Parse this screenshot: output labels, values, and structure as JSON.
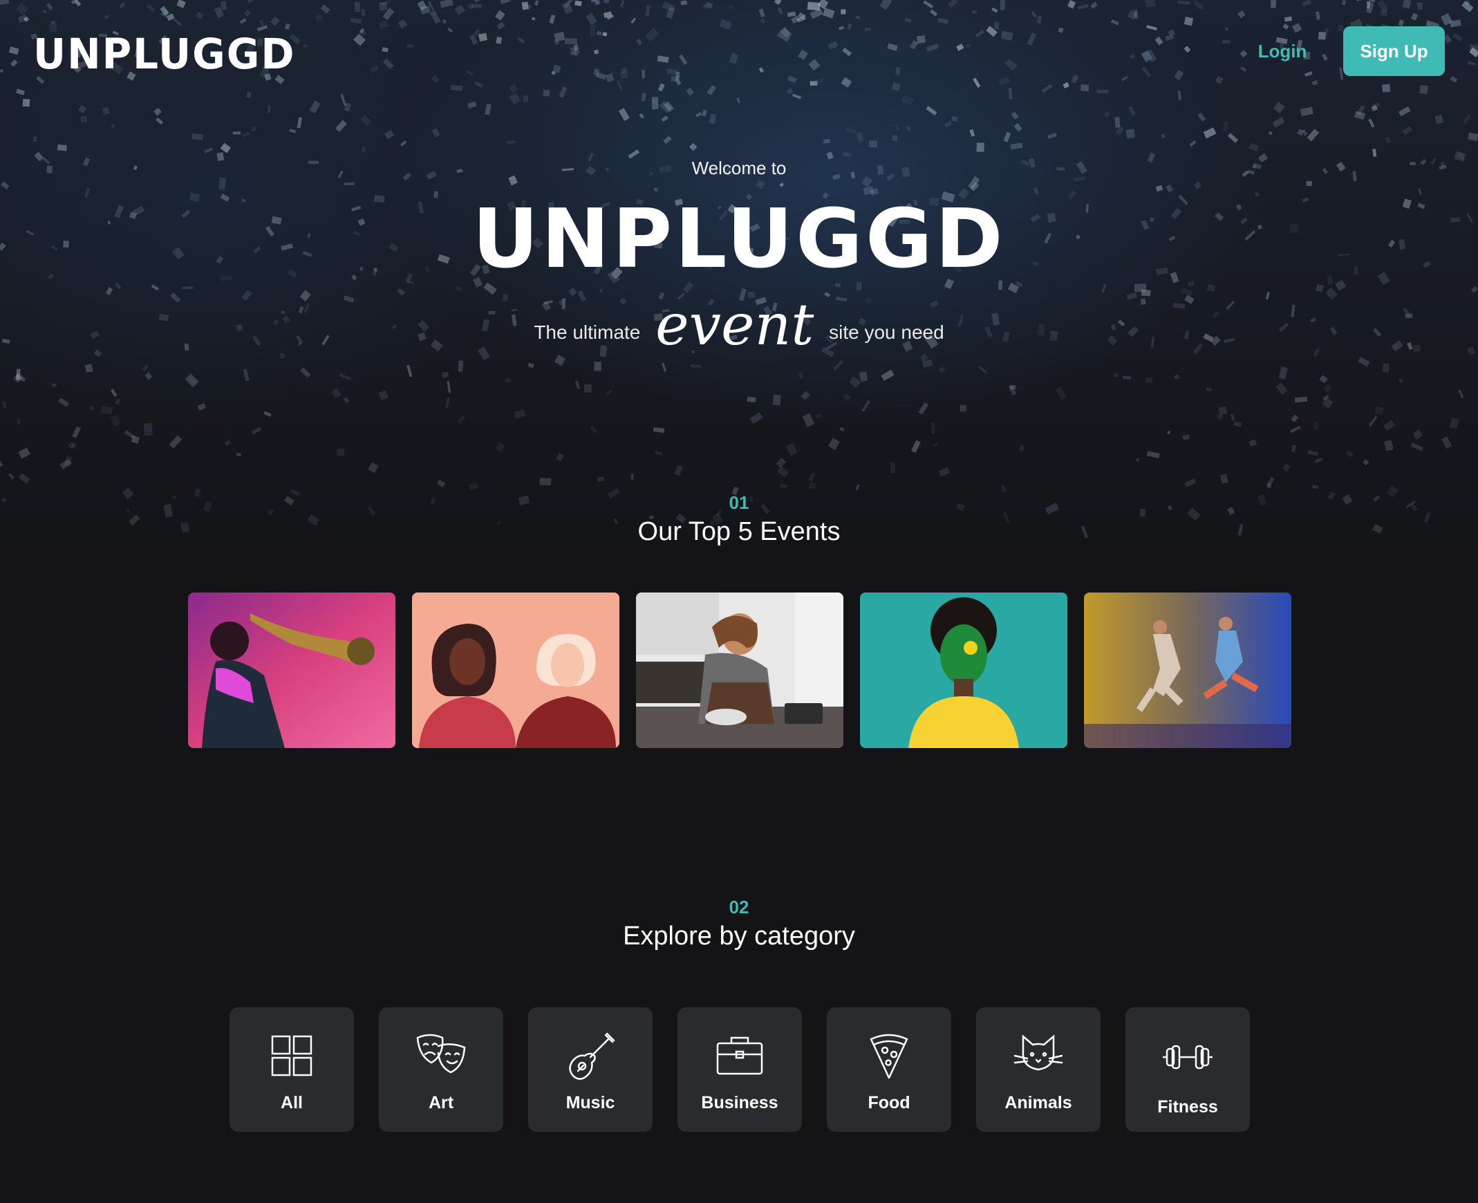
{
  "header": {
    "logo": "UNPLUGGD",
    "login_label": "Login",
    "signup_label": "Sign Up"
  },
  "hero": {
    "welcome": "Welcome to",
    "title": "UNPLUGGD",
    "tagline_before": "The ultimate",
    "tagline_script": "event",
    "tagline_after": "site you need"
  },
  "top_events": {
    "number": "01",
    "title": "Our Top 5 Events",
    "cards": [
      {
        "subject": "saxophone player"
      },
      {
        "subject": "two women illustration"
      },
      {
        "subject": "woman baking"
      },
      {
        "subject": "face painted fan"
      },
      {
        "subject": "dancers"
      }
    ]
  },
  "categories": {
    "number": "02",
    "title": "Explore by category",
    "items": [
      {
        "label": "All",
        "icon": "grid-icon"
      },
      {
        "label": "Art",
        "icon": "theater-masks-icon"
      },
      {
        "label": "Music",
        "icon": "guitar-icon"
      },
      {
        "label": "Business",
        "icon": "briefcase-icon"
      },
      {
        "label": "Food",
        "icon": "pizza-icon"
      },
      {
        "label": "Animals",
        "icon": "cat-icon"
      },
      {
        "label": "Fitness",
        "icon": "dumbbell-icon"
      }
    ]
  },
  "colors": {
    "accent": "#3fbab4",
    "background": "#141417",
    "card": "#2a2b2f"
  }
}
